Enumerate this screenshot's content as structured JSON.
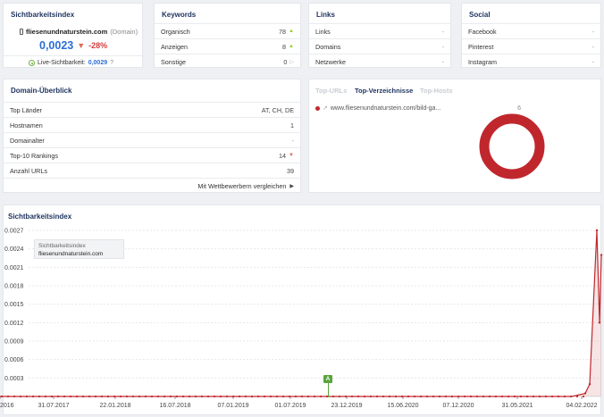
{
  "sichtbarkeit": {
    "title": "Sichtbarkeitsindex",
    "domain": "fliesenundnaturstein.com",
    "domain_suffix": "(Domain)",
    "value": "0,0023",
    "change": "-28%",
    "live_label": "Live-Sichtbarkeit:",
    "live_value": "0,0029",
    "help": "?"
  },
  "keywords": {
    "title": "Keywords",
    "rows": [
      {
        "label": "Organisch",
        "value": "78"
      },
      {
        "label": "Anzeigen",
        "value": "8"
      },
      {
        "label": "Sonstige",
        "value": "0"
      }
    ]
  },
  "links": {
    "title": "Links",
    "rows": [
      {
        "label": "Links",
        "value": "-"
      },
      {
        "label": "Domains",
        "value": "-"
      },
      {
        "label": "Netzwerke",
        "value": "-"
      }
    ]
  },
  "social": {
    "title": "Social",
    "rows": [
      {
        "label": "Facebook",
        "value": "-"
      },
      {
        "label": "Pinterest",
        "value": "-"
      },
      {
        "label": "Instagram",
        "value": "-"
      }
    ]
  },
  "overview": {
    "title": "Domain-Überblick",
    "rows": [
      {
        "label": "Top Länder",
        "value": "AT, CH, DE"
      },
      {
        "label": "Hostnamen",
        "value": "1"
      },
      {
        "label": "Domainalter",
        "value": "-"
      },
      {
        "label": "Top-10 Rankings",
        "value": "14"
      },
      {
        "label": "Anzahl URLs",
        "value": "39"
      }
    ],
    "compare_link": "Mit Wettbewerbern vergleichen"
  },
  "tops": {
    "tabs": [
      "Top-URLs",
      "Top-Verzeichnisse",
      "Top-Hosts"
    ],
    "active_tab": "Top-Verzeichnisse",
    "entry": "www.fliesenundnaturstein.com/bild-ga...",
    "entry_count": "6",
    "ring_color": "#c0272d"
  },
  "chart_title": "Sichtbarkeitsindex",
  "legend": {
    "line1": "Sichtbarkeitsindex",
    "line2": "fliesenundnaturstein.com"
  },
  "annotation": "A",
  "chart_data": {
    "type": "line",
    "title": "Sichtbarkeitsindex",
    "series_color": "#c0272d",
    "y_ticks": [
      "0.0027",
      "0.0024",
      "0.0021",
      "0.0018",
      "0.0015",
      "0.0012",
      "0.0009",
      "0.0006",
      "0.0003"
    ],
    "ylim": [
      0,
      0.0027
    ],
    "x_ticks": [
      "2016",
      "31.07.2017",
      "22.01.2018",
      "16.07.2018",
      "07.01.2019",
      "01.07.2019",
      "23.12.2019",
      "15.06.2020",
      "07.12.2020",
      "31.05.2021",
      "04.02.2022"
    ],
    "grid": true,
    "series": [
      {
        "name": "fliesenundnaturstein.com",
        "x": [
          "2016",
          "31.07.2017",
          "22.01.2018",
          "16.07.2018",
          "07.01.2019",
          "01.07.2019",
          "23.12.2019",
          "15.06.2020",
          "07.12.2020",
          "31.05.2021",
          "2021-11",
          "2022-01",
          "04.02.2022",
          "2022-02-15",
          "2022-02-25",
          "2022-03-05"
        ],
        "y": [
          0,
          0,
          0,
          0,
          0,
          0,
          0,
          0,
          0,
          0,
          0,
          5e-05,
          0.0002,
          0.0027,
          0.0012,
          0.0023
        ]
      }
    ]
  }
}
